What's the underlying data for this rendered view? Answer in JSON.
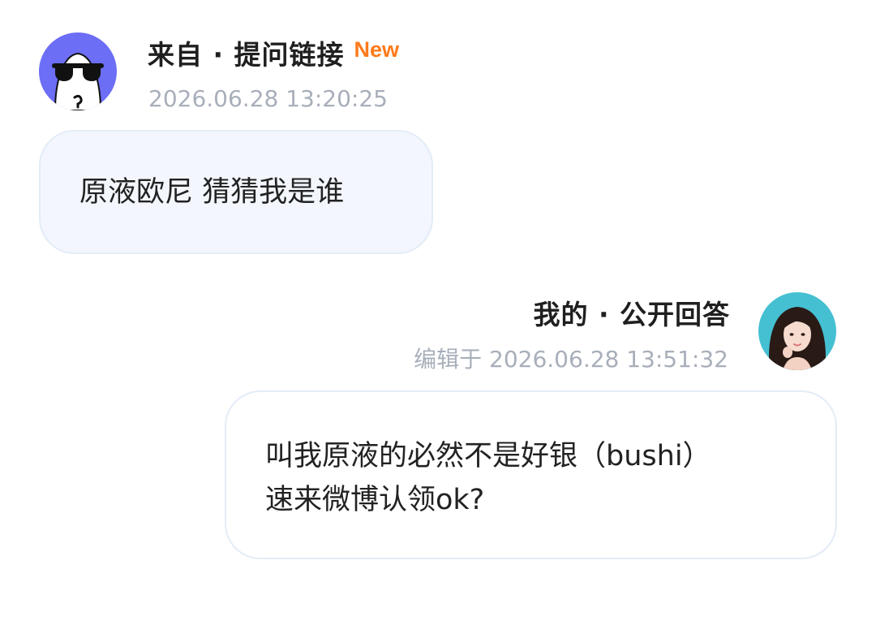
{
  "question": {
    "title": "来自 · 提问链接",
    "badge": "New",
    "timestamp": "2026.06.28 13:20:25",
    "text": "原液欧尼 猜猜我是谁",
    "avatar_icon": "sunglasses-ghost-avatar"
  },
  "answer": {
    "title": "我的 · 公开回答",
    "timestamp": "编辑于 2026.06.28 13:51:32",
    "lines": [
      "叫我原液的必然不是好银（bushi）",
      "速来微博认领ok?"
    ],
    "avatar_icon": "user-photo-avatar"
  },
  "colors": {
    "accent_new": "#ff7a1a",
    "avatar_left_bg": "#6c6ef6",
    "avatar_right_bg": "#45c0d2",
    "question_bubble_bg": "#f3f7fd",
    "bubble_border": "#e3ecf7",
    "timestamp": "#a8afba"
  }
}
